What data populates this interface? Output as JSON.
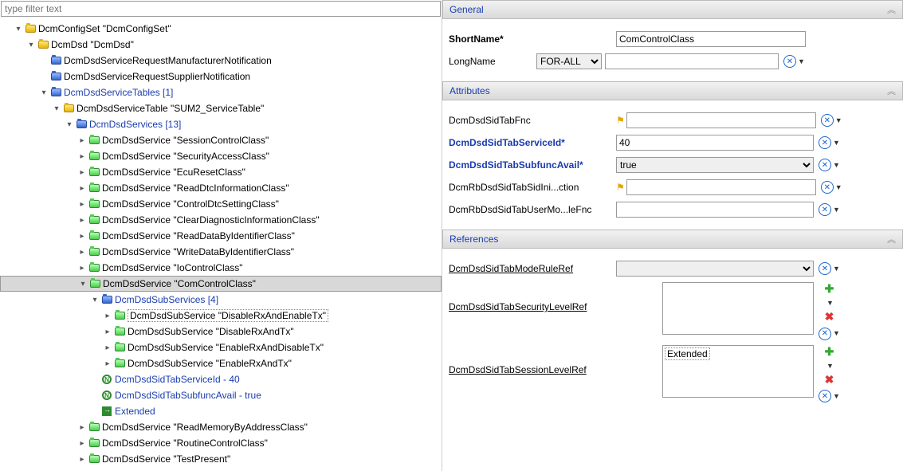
{
  "filter": {
    "placeholder": "type filter text"
  },
  "tree": {
    "n0": "DcmConfigSet \"DcmConfigSet\"",
    "n1": "DcmDsd \"DcmDsd\"",
    "n2": "DcmDsdServiceRequestManufacturerNotification",
    "n3": "DcmDsdServiceRequestSupplierNotification",
    "n4": "DcmDsdServiceTables [1]",
    "n5": "DcmDsdServiceTable \"SUM2_ServiceTable\"",
    "n6": "DcmDsdServices [13]",
    "s0": "DcmDsdService \"SessionControlClass\"",
    "s1": "DcmDsdService \"SecurityAccessClass\"",
    "s2": "DcmDsdService \"EcuResetClass\"",
    "s3": "DcmDsdService \"ReadDtcInformationClass\"",
    "s4": "DcmDsdService \"ControlDtcSettingClass\"",
    "s5": "DcmDsdService \"ClearDiagnosticInformationClass\"",
    "s6": "DcmDsdService \"ReadDataByIdentifierClass\"",
    "s7": "DcmDsdService \"WriteDataByIdentifierClass\"",
    "s8": "DcmDsdService \"IoControlClass\"",
    "s9": "DcmDsdService \"ComControlClass\"",
    "sub": "DcmDsdSubServices [4]",
    "ss0": "DcmDsdSubService \"DisableRxAndEnableTx\"",
    "ss1": "DcmDsdSubService \"DisableRxAndTx\"",
    "ss2": "DcmDsdSubService \"EnableRxAndDisableTx\"",
    "ss3": "DcmDsdSubService \"EnableRxAndTx\"",
    "a0": "DcmDsdSidTabServiceId - 40",
    "a1": "DcmDsdSidTabSubfuncAvail - true",
    "r0": "Extended",
    "s10": "DcmDsdService \"ReadMemoryByAddressClass\"",
    "s11": "DcmDsdService \"RoutineControlClass\"",
    "s12": "DcmDsdService \"TestPresent\""
  },
  "general": {
    "title": "General",
    "shortname_label": "ShortName*",
    "shortname_value": "ComControlClass",
    "longname_label": "LongName",
    "longname_select": "FOR-ALL"
  },
  "attributes": {
    "title": "Attributes",
    "f0_label": "DcmDsdSidTabFnc",
    "f1_label": "DcmDsdSidTabServiceId*",
    "f1_value": "40",
    "f2_label": "DcmDsdSidTabSubfuncAvail*",
    "f2_value": "true",
    "f3_label": "DcmRbDsdSidTabSidIni...ction",
    "f4_label": "DcmRbDsdSidTabUserMo...leFnc"
  },
  "references": {
    "title": "References",
    "r0_label": "DcmDsdSidTabModeRuleRef",
    "r1_label": "DcmDsdSidTabSecurityLevelRef",
    "r2_label": "DcmDsdSidTabSessionLevelRef",
    "r2_item": "Extended"
  }
}
